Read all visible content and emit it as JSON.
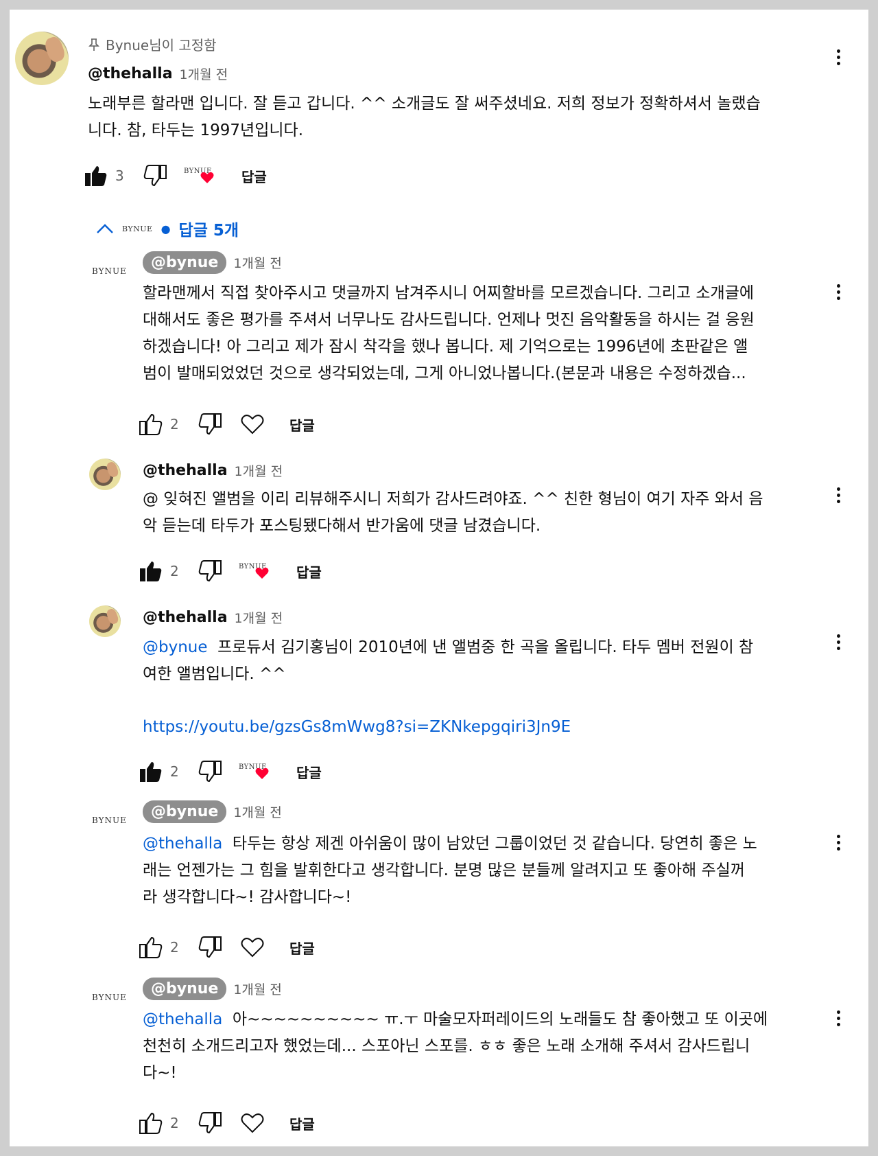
{
  "pinned_label": "Bynue님이 고정함",
  "top_comment": {
    "author": "@thehalla",
    "time": "1개월 전",
    "text": "노래부른 할라맨 입니다. 잘 듣고 갑니다. ^^ 소개글도 잘 써주셨네요. 저희 정보가 정확하셔서 놀랬습\n니다. 참, 타두는 1997년입니다.",
    "likes": "3",
    "reply_label": "답글",
    "creator_logo": "BYNUE"
  },
  "replies_toggle": {
    "logo": "BYNUE",
    "label": "답글 5개"
  },
  "replies": [
    {
      "author": "@bynue",
      "is_creator": true,
      "time": "1개월 전",
      "mention": "",
      "text": "할라맨께서 직접 찾아주시고 댓글까지 남겨주시니 어찌할바를 모르겠습니다. 그리고 소개글에\n대해서도 좋은 평가를 주셔서 너무나도 감사드립니다. 언제나 멋진 음악활동을 하시는 걸 응원\n하겠습니다! 아 그리고 제가 잠시 착각을 했나 봅니다. 제 기억으로는 1996년에 초판같은 앨\n범이 발매되었었던 것으로 생각되었는데, 그게 아니었나봅니다.(본문과 내용은 수정하겠습...",
      "link": "",
      "likes": "2",
      "liked": false,
      "hearted": false,
      "reply_label": "답글"
    },
    {
      "author": "@thehalla",
      "is_creator": false,
      "time": "1개월 전",
      "mention": "",
      "text": "@ 잊혀진 앨범을 이리 리뷰해주시니 저희가 감사드려야죠. ^^ 친한 형님이 여기 자주 와서 음\n악 듣는데 타두가 포스팅됐다해서 반가움에 댓글 남겼습니다.",
      "link": "",
      "likes": "2",
      "liked": true,
      "hearted": true,
      "reply_label": "답글"
    },
    {
      "author": "@thehalla",
      "is_creator": false,
      "time": "1개월 전",
      "mention": "@bynue",
      "text": "  프로듀서 김기홍님이 2010년에 낸 앨범중 한 곡을 올립니다. 타두 멤버 전원이 참\n여한 앨범입니다. ^^",
      "link": "https://youtu.be/gzsGs8mWwg8?si=ZKNkepgqiri3Jn9E",
      "likes": "2",
      "liked": true,
      "hearted": true,
      "reply_label": "답글"
    },
    {
      "author": "@bynue",
      "is_creator": true,
      "time": "1개월 전",
      "mention": "@thehalla",
      "text": "  타두는 항상 제겐 아쉬움이 많이 남았던 그룹이었던 것 같습니다. 당연히 좋은 노\n래는 언젠가는 그 힘을 발휘한다고 생각합니다. 분명 많은 분들께 알려지고 또 좋아해 주실꺼\n라 생각합니다~! 감사합니다~!",
      "link": "",
      "likes": "2",
      "liked": false,
      "hearted": false,
      "reply_label": "답글"
    },
    {
      "author": "@bynue",
      "is_creator": true,
      "time": "1개월 전",
      "mention": "@thehalla",
      "text": "  아~~~~~~~~~~ ㅠ.ㅜ 마술모자퍼레이드의 노래들도 참 좋아했고 또 이곳에\n천천히 소개드리고자 했었는데... 스포아닌 스포를. ㅎㅎ 좋은 노래 소개해 주셔서 감사드립니\n다~!",
      "link": "",
      "likes": "2",
      "liked": false,
      "hearted": false,
      "reply_label": "답글"
    }
  ]
}
